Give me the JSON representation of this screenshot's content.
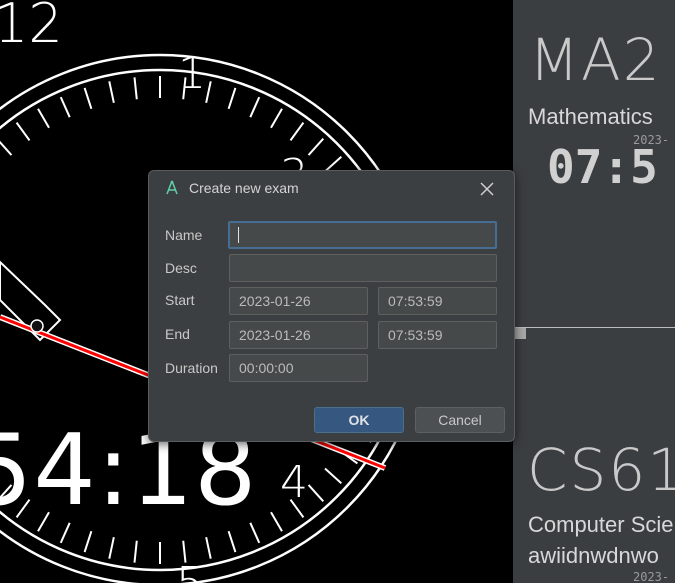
{
  "background": {
    "clock": {
      "hour_display": "12",
      "dial_numbers": [
        "1",
        "3",
        "4",
        "5"
      ],
      "time_display": "54:18"
    },
    "exam_cards": [
      {
        "code": "MA2",
        "subject": "Mathematics",
        "date": "2023-",
        "time": "07:5"
      },
      {
        "code": "CS61",
        "subject": "Computer Scie",
        "desc": "awiidnwdnwo",
        "date": "2023-"
      }
    ]
  },
  "dialog": {
    "title": "Create new exam",
    "icon": "compass-app-icon",
    "close_icon": "close-icon",
    "labels": {
      "name": "Name",
      "desc": "Desc",
      "start": "Start",
      "end": "End",
      "duration": "Duration"
    },
    "fields": {
      "name": "",
      "desc": "",
      "start_date": "2023-01-26",
      "start_time": "07:53:59",
      "end_date": "2023-01-26",
      "end_time": "07:53:59",
      "duration": "00:00:00"
    },
    "buttons": {
      "ok": "OK",
      "cancel": "Cancel"
    }
  },
  "colors": {
    "accent": "#365880",
    "focus_border": "#466d94",
    "dialog_bg": "#3c3f41",
    "panel_bg": "#3b3e41",
    "second_hand": "#ff0000"
  }
}
